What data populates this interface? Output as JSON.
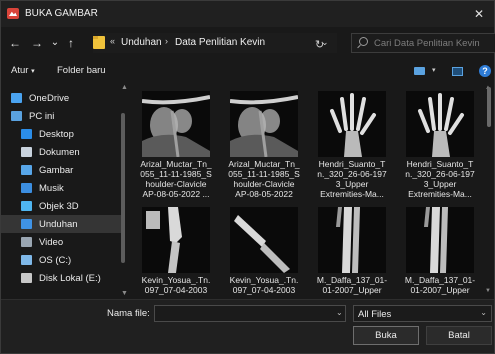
{
  "window": {
    "title": "BUKA GAMBAR",
    "close": "✕"
  },
  "nav": {
    "back": "←",
    "forward": "→",
    "recent": "⌄",
    "up": "↑",
    "overflow": "«",
    "breadcrumb": [
      "Unduhan",
      "Data Penlitian Kevin"
    ],
    "refresh": "↻",
    "search_placeholder": "Cari Data Penlitian Kevin"
  },
  "toolbar": {
    "organize": "Atur",
    "new_folder": "Folder baru",
    "help": "?"
  },
  "sidebar": {
    "items": [
      {
        "label": "OneDrive",
        "icon": "onedrive-icon",
        "color": "#4aa3f0"
      },
      {
        "label": "PC ini",
        "icon": "pc-icon",
        "color": "#5aa2e0"
      },
      {
        "label": "Desktop",
        "icon": "desktop-icon",
        "color": "#2b8de8"
      },
      {
        "label": "Dokumen",
        "icon": "documents-icon",
        "color": "#c9d3de"
      },
      {
        "label": "Gambar",
        "icon": "pictures-icon",
        "color": "#58a6e8"
      },
      {
        "label": "Musik",
        "icon": "music-icon",
        "color": "#3c8ee0"
      },
      {
        "label": "Objek 3D",
        "icon": "3d-objects-icon",
        "color": "#4fb5f0"
      },
      {
        "label": "Unduhan",
        "icon": "downloads-icon",
        "color": "#3f93e6"
      },
      {
        "label": "Video",
        "icon": "videos-icon",
        "color": "#9aa6b2"
      },
      {
        "label": "OS (C:)",
        "icon": "drive-c-icon",
        "color": "#7fb8e8"
      },
      {
        "label": "Disk Lokal (E:)",
        "icon": "drive-e-icon",
        "color": "#c8c8c8"
      }
    ],
    "selected": "Unduhan"
  },
  "files": [
    {
      "label": "Arizal_Muctar_Tn_\n055_11-11-1985_S\nhoulder-Clavicle\nAP-08-05-2022 ...",
      "kind": "shoulder"
    },
    {
      "label": "Arizal_Muctar_Tn_\n055_11-11-1985_S\nhoulder-Clavicle\nAP-08-05-2022",
      "kind": "shoulder"
    },
    {
      "label": "Hendri_Suanto_T\nn._320_26-06-197\n3_Upper\nExtremities-Ma...",
      "kind": "hand"
    },
    {
      "label": "Hendri_Suanto_T\nn._320_26-06-197\n3_Upper\nExtremities-Ma...",
      "kind": "hand"
    },
    {
      "label": "Kevin_Yosua_.Tn.\n097_07-04-2003",
      "kind": "elbow"
    },
    {
      "label": "Kevin_Yosua_.Tn.\n097_07-04-2003",
      "kind": "elbow2"
    },
    {
      "label": "M._Daffa_137_01-\n01-2007_Upper",
      "kind": "forearm"
    },
    {
      "label": "M._Daffa_137_01-\n01-2007_Upper",
      "kind": "forearm"
    }
  ],
  "footer": {
    "filename_label": "Nama file:",
    "filename_value": "",
    "filetype": "All Files",
    "open": "Buka",
    "cancel": "Batal"
  }
}
